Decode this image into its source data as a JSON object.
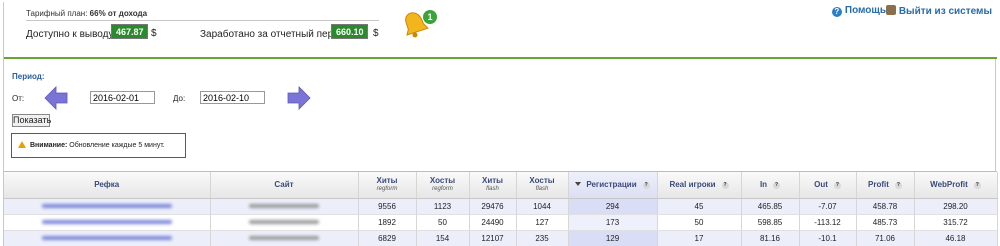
{
  "header": {
    "plan_label": "Тарифный план:",
    "plan_value": "66% от дохода",
    "available_label": "Доступно к выводу:",
    "available_value": "467.87",
    "available_currency": "$",
    "earned_label": "Заработано за отчетный период:",
    "earned_value": "660.10",
    "earned_currency": "$",
    "notification_count": "1",
    "help_label": "Помощь",
    "logout_label": "Выйти из системы"
  },
  "period": {
    "title": "Период:",
    "from_label": "От:",
    "from_value": "2016-02-01",
    "to_label": "До:",
    "to_value": "2016-02-10",
    "show_button": "Показать"
  },
  "notice": {
    "bold": "Внимание:",
    "text": "Обновление каждые 5 минут."
  },
  "table": {
    "columns": [
      {
        "label": "Рефка",
        "sub": ""
      },
      {
        "label": "Сайт",
        "sub": ""
      },
      {
        "label": "Хиты",
        "sub": "regform"
      },
      {
        "label": "Хосты",
        "sub": "regform"
      },
      {
        "label": "Хиты",
        "sub": "flash"
      },
      {
        "label": "Хосты",
        "sub": "flash"
      },
      {
        "label": "Регистрации",
        "sub": ""
      },
      {
        "label": "Real игроки",
        "sub": ""
      },
      {
        "label": "In",
        "sub": ""
      },
      {
        "label": "Out",
        "sub": ""
      },
      {
        "label": "Profit",
        "sub": ""
      },
      {
        "label": "WebProfit",
        "sub": ""
      }
    ],
    "help_glyph": "?",
    "rows": [
      [
        "",
        "",
        "9556",
        "1123",
        "29476",
        "1044",
        "294",
        "45",
        "465.85",
        "-7.07",
        "458.78",
        "298.20"
      ],
      [
        "",
        "",
        "1892",
        "50",
        "24490",
        "127",
        "173",
        "50",
        "598.85",
        "-113.12",
        "485.73",
        "315.72"
      ],
      [
        "",
        "",
        "6829",
        "154",
        "12107",
        "235",
        "129",
        "17",
        "81.16",
        "-10.1",
        "71.06",
        "46.18"
      ]
    ]
  },
  "colors": {
    "accent_green": "#6aa532",
    "balance_box": "#2b8a2b",
    "link_blue": "#2a6ba8",
    "warning_border": "#b53333",
    "arrow_purple": "#7a74d6"
  }
}
